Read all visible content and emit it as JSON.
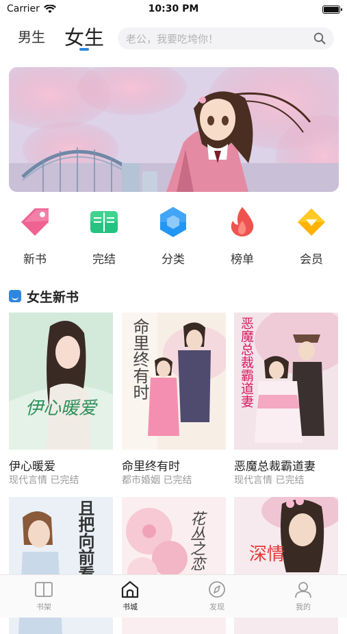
{
  "status_bar": {
    "carrier": "Carrier",
    "time": "10:30 PM"
  },
  "header": {
    "tabs": [
      {
        "label": "男生",
        "active": false
      },
      {
        "label": "女生",
        "active": true
      }
    ],
    "search_placeholder": "老公，我要吃垮你！",
    "accent_color": "#2e86de"
  },
  "banner": {
    "icon": "anime-girl-cherry-blossom-illustration"
  },
  "categories": [
    {
      "label": "新书",
      "icon": "tag-icon",
      "color": "#f06292"
    },
    {
      "label": "完结",
      "icon": "book-open-icon",
      "color": "#26c281"
    },
    {
      "label": "分类",
      "icon": "hexagon-icon",
      "color": "#2196f3"
    },
    {
      "label": "榜单",
      "icon": "flame-icon",
      "color": "#ef5350"
    },
    {
      "label": "会员",
      "icon": "diamond-icon",
      "color": "#ffb300"
    }
  ],
  "section": {
    "title": "女生新书"
  },
  "books": [
    {
      "title": "伊心暖爱",
      "meta": "现代言情 已完结",
      "cover_text": "伊心暖爱"
    },
    {
      "title": "命里终有时",
      "meta": "都市婚姻 已完结",
      "cover_text": "命里终有时"
    },
    {
      "title": "恶魔总裁霸道妻",
      "meta": "现代言情 已完结",
      "cover_text": "恶魔总裁霸道妻"
    },
    {
      "title": "",
      "meta": "",
      "cover_text": "且把向前看"
    },
    {
      "title": "",
      "meta": "",
      "cover_text": "花丛之恋"
    },
    {
      "title": "",
      "meta": "",
      "cover_text": "深情"
    }
  ],
  "tabbar": [
    {
      "label": "书架",
      "icon": "bookshelf-icon",
      "active": false
    },
    {
      "label": "书城",
      "icon": "home-icon",
      "active": true
    },
    {
      "label": "发现",
      "icon": "compass-icon",
      "active": false
    },
    {
      "label": "我的",
      "icon": "user-icon",
      "active": false
    }
  ]
}
